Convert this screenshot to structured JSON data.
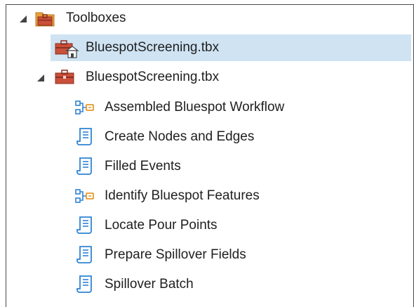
{
  "tree": {
    "root": {
      "label": "Toolboxes",
      "icon": "toolboxes-folder-icon",
      "expanded": true
    },
    "items": [
      {
        "label": "BluespotScreening.tbx",
        "icon": "home-toolbox-icon",
        "selected": true
      },
      {
        "label": "BluespotScreening.tbx",
        "icon": "toolbox-icon",
        "expanded": true,
        "children": [
          {
            "label": "Assembled Bluespot Workflow",
            "icon": "model-tool-icon"
          },
          {
            "label": "Create Nodes and Edges",
            "icon": "script-tool-icon"
          },
          {
            "label": "Filled Events",
            "icon": "script-tool-icon"
          },
          {
            "label": "Identify Bluespot Features",
            "icon": "model-tool-icon"
          },
          {
            "label": "Locate Pour Points",
            "icon": "script-tool-icon"
          },
          {
            "label": "Prepare Spillover Fields",
            "icon": "script-tool-icon"
          },
          {
            "label": "Spillover Batch",
            "icon": "script-tool-icon"
          }
        ]
      }
    ]
  },
  "colors": {
    "selection": "#cfe3f3",
    "toolbox_red": "#c9503a",
    "toolbox_orange": "#e9a23b",
    "tool_blue": "#2f84d3",
    "model_orange": "#e39a2d"
  }
}
